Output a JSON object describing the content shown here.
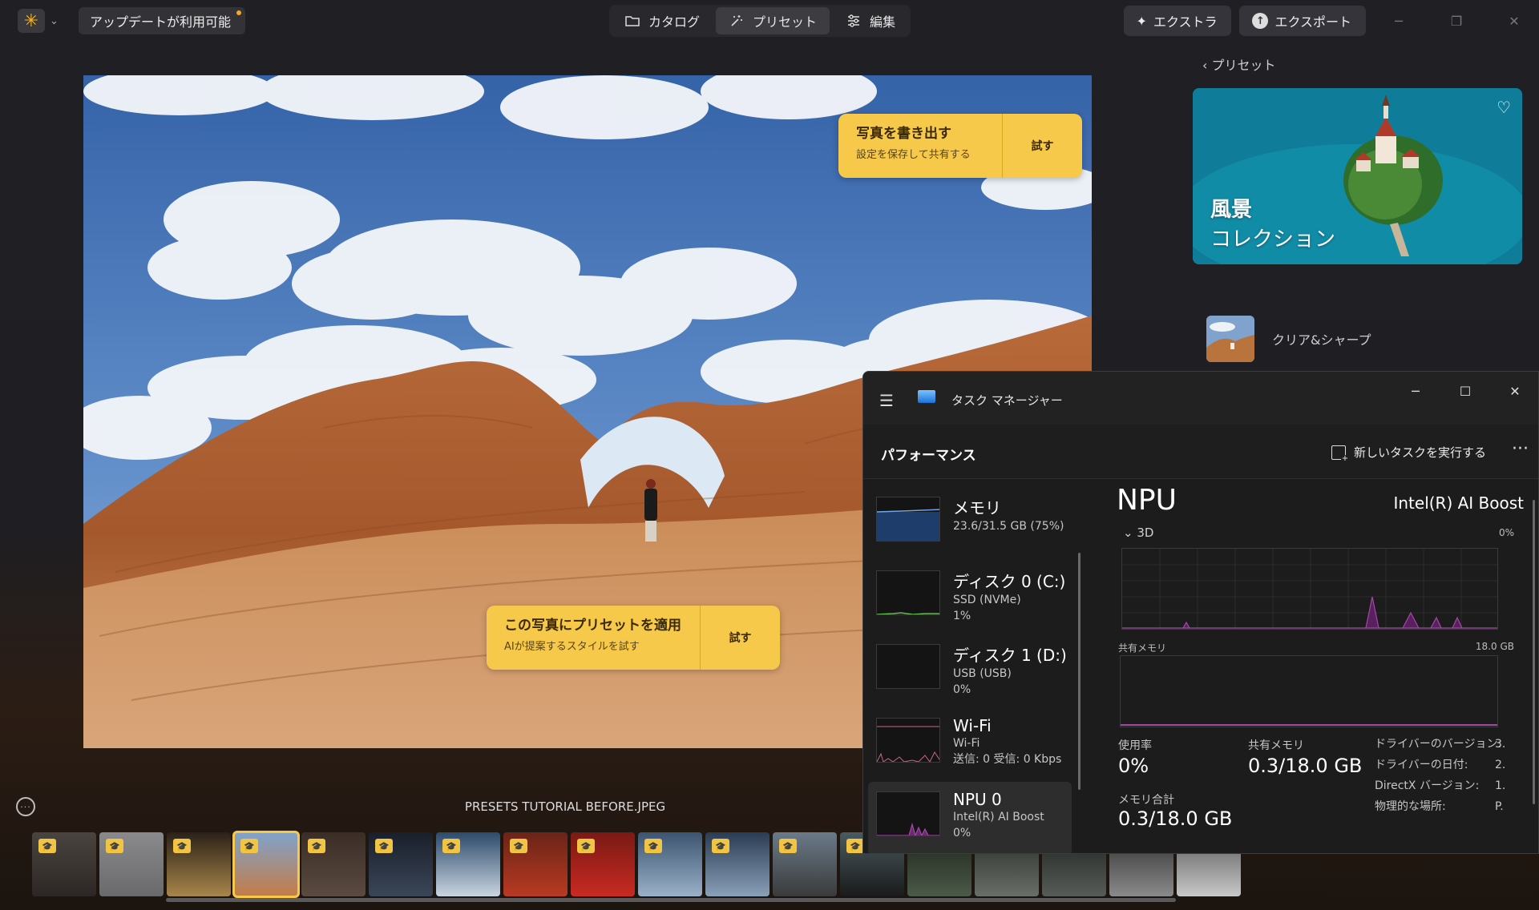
{
  "titlebar": {
    "update_label": "アップデートが利用可能",
    "nav": [
      {
        "label": "カタログ",
        "icon": "folder-icon"
      },
      {
        "label": "プリセット",
        "icon": "magic-wand-icon"
      },
      {
        "label": "編集",
        "icon": "sliders-icon"
      }
    ],
    "extras_label": "エクストラ",
    "export_label": "エクスポート"
  },
  "photo": {
    "export_card": {
      "title": "写真を書き出す",
      "subtitle": "設定を保存して共有する",
      "try": "試す"
    },
    "preset_card": {
      "title": "この写真にプリセットを適用",
      "subtitle": "AIが提案するスタイルを試す",
      "try": "試す"
    }
  },
  "panel": {
    "back_label": "プリセット",
    "collection_line1": "風景",
    "collection_line2": "コレクション",
    "preset_name": "クリア&シャープ"
  },
  "filmstrip": {
    "filename": "PRESETS TUTORIAL BEFORE.JPEG",
    "selected_index": 3
  },
  "task_manager": {
    "title": "タスク マネージャー",
    "section": "パフォーマンス",
    "run_task": "新しいタスクを実行する",
    "items": [
      {
        "name": "メモリ",
        "sub1": "23.6/31.5 GB (75%)",
        "sub2": "",
        "sub3": ""
      },
      {
        "name": "ディスク 0 (C:)",
        "sub1": "SSD (NVMe)",
        "sub2": "1%",
        "sub3": ""
      },
      {
        "name": "ディスク 1 (D:)",
        "sub1": "USB (USB)",
        "sub2": "0%",
        "sub3": ""
      },
      {
        "name": "Wi-Fi",
        "sub1": "Wi-Fi",
        "sub2": "送信: 0 受信: 0 Kbps",
        "sub3": ""
      },
      {
        "name": "NPU 0",
        "sub1": "Intel(R) AI Boost",
        "sub2": "0%",
        "sub3": ""
      }
    ],
    "npu": {
      "title": "NPU",
      "model": "Intel(R) AI Boost",
      "graph_label": "3D",
      "graph_pct": "0%",
      "shared_label": "共有メモリ",
      "shared_max": "18.0 GB",
      "usage_label": "使用率",
      "usage_value": "0%",
      "shared_mem_label": "共有メモリ",
      "shared_mem_value": "0.3/18.0 GB",
      "mem_total_label": "メモリ合計",
      "mem_total_value": "0.3/18.0 GB",
      "driver_version_label": "ドライバーのバージョン:",
      "driver_version_value": "3.",
      "driver_date_label": "ドライバーの日付:",
      "driver_date_value": "2.",
      "directx_label": "DirectX バージョン:",
      "directx_value": "1.",
      "location_label": "物理的な場所:",
      "location_value": "P."
    }
  }
}
